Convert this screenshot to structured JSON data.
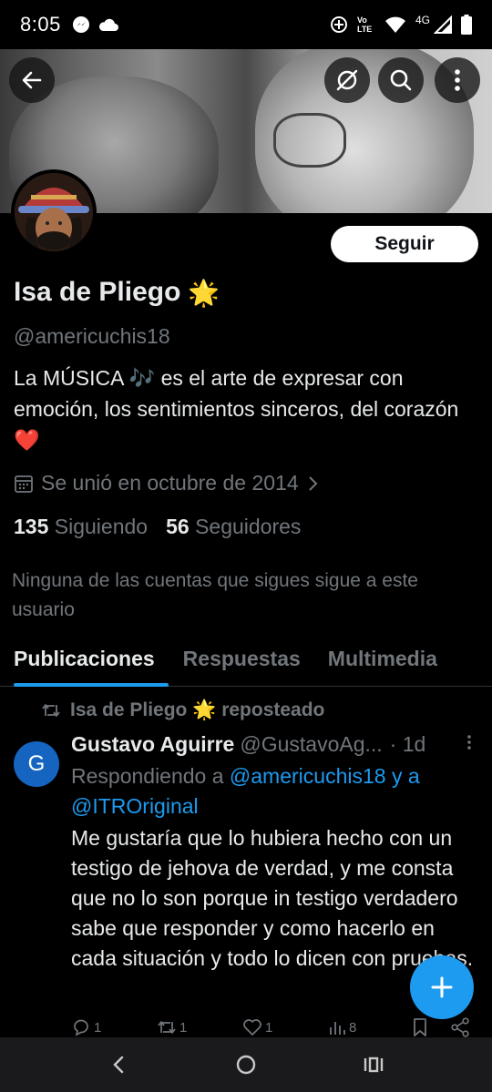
{
  "status_bar": {
    "time": "8:05",
    "network": "4G",
    "volte": "Vo LTE"
  },
  "profile": {
    "name": "Isa de Pliego",
    "name_emoji": "🌟",
    "handle": "@americuchis18",
    "bio": "La MÚSICA 🎶 es el arte de expresar con emoción, los sentimientos sinceros, del corazón ❤️",
    "joined": "Se unió en octubre de 2014",
    "following_count": "135",
    "following_label": "Siguiendo",
    "followers_count": "56",
    "followers_label": "Seguidores",
    "notice": "Ninguna de las cuentas que sigues sigue a este usuario",
    "follow_button": "Seguir"
  },
  "tabs": [
    {
      "label": "Publicaciones",
      "active": true
    },
    {
      "label": "Respuestas",
      "active": false
    },
    {
      "label": "Multimedia",
      "active": false
    }
  ],
  "post": {
    "repost_text": "Isa de Pliego 🌟 reposteado",
    "avatar_letter": "G",
    "author_name": "Gustavo Aguirre",
    "author_handle": "@GustavoAg...",
    "time": "· 1d",
    "replying_prefix": "Respondiendo a",
    "replying_to": "@americuchis18 y a @ITROriginal",
    "body": "Me gustaría que lo hubiera hecho con un testigo de jehova de verdad, y me consta que no lo son porque in testigo verdadero sabe que responder y como hacerlo en cada situación y todo lo dicen con pruebas.",
    "replies": "1",
    "reposts": "1",
    "likes": "1",
    "views": "8"
  },
  "colors": {
    "accent": "#1d9bf0",
    "background": "#000000",
    "secondary_text": "#71767b",
    "primary_text": "#e7e9ea"
  }
}
